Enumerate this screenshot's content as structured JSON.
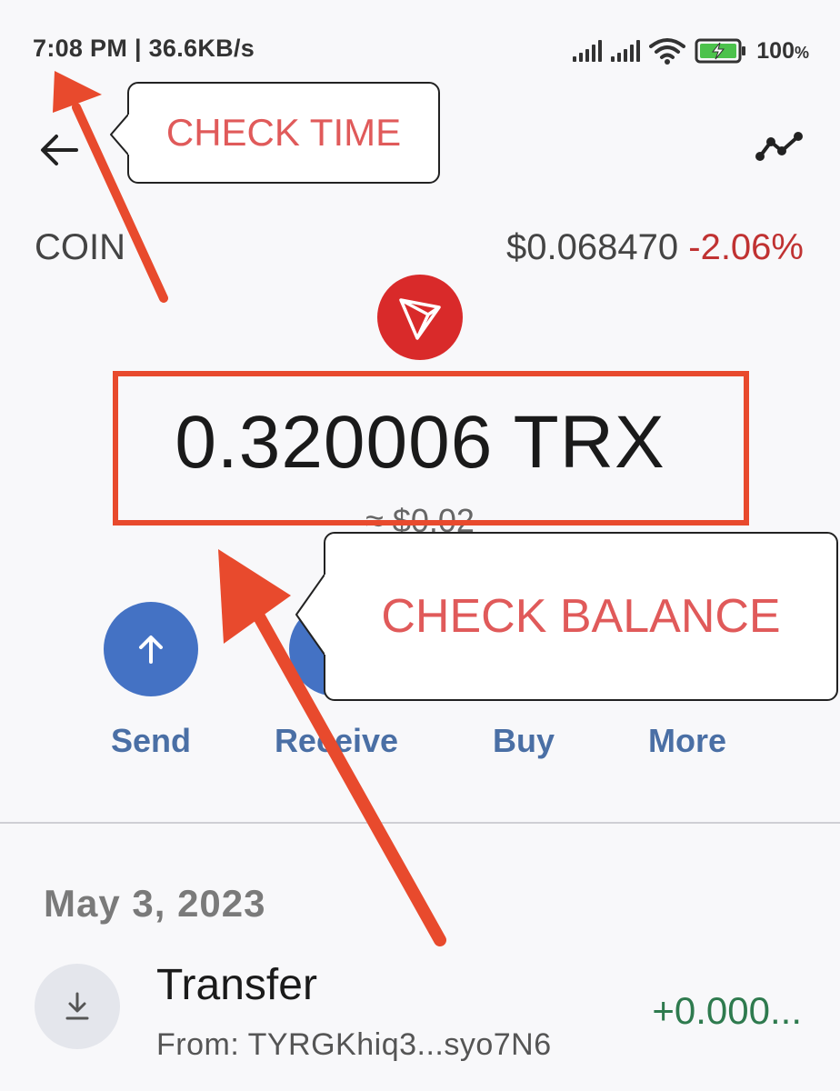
{
  "status_bar": {
    "time_speed": "7:08 PM | 36.6KB/s",
    "battery_level": "100",
    "battery_unit": "%"
  },
  "header": {
    "back_icon": "arrow-left-icon",
    "chart_icon": "trend-chart-icon"
  },
  "coin": {
    "label": "COIN",
    "price": "$0.068470",
    "change": "-2.06%",
    "icon": "tron-logo-icon"
  },
  "balance": {
    "amount": "0.320006 TRX",
    "usd": "≈ $0.02"
  },
  "actions": [
    {
      "label": "Send",
      "icon": "arrow-up-icon"
    },
    {
      "label": "Receive",
      "icon": "arrow-down-icon"
    },
    {
      "label": "Buy",
      "icon": "card-icon"
    },
    {
      "label": "More",
      "icon": "more-icon"
    }
  ],
  "transactions": {
    "date": "May 3, 2023",
    "items": [
      {
        "title": "Transfer",
        "from": "From: TYRGKhiq3...syo7N6",
        "amount": "+0.000...",
        "icon": "download-icon"
      }
    ]
  },
  "annotations": {
    "time_callout": "CHECK TIME",
    "balance_callout": "CHECK BALANCE",
    "accent_color": "#e84a2d"
  }
}
